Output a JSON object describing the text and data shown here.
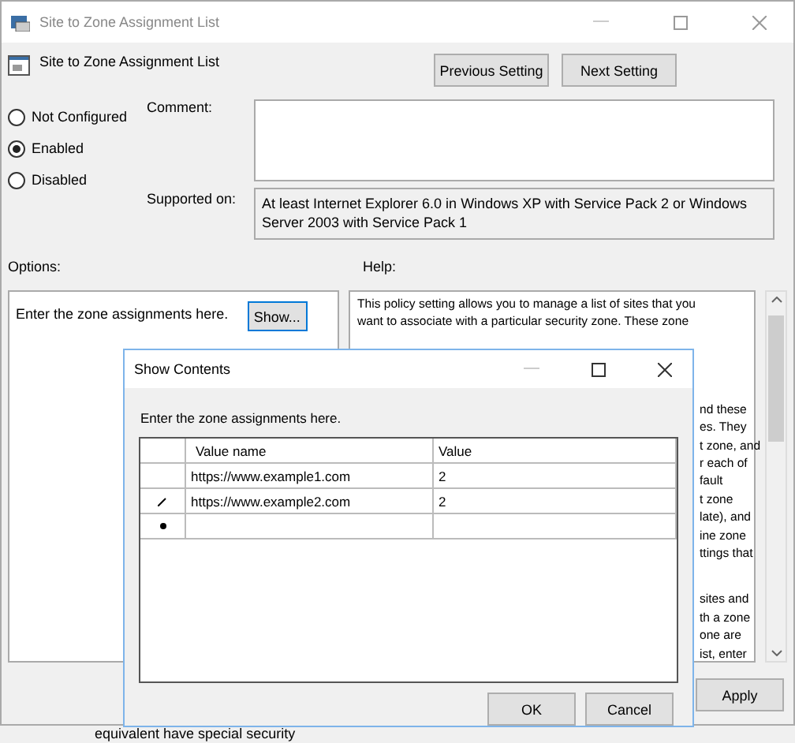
{
  "window": {
    "title": "Site to Zone Assignment List"
  },
  "header": {
    "title": "Site to Zone Assignment List",
    "buttons": [
      "Previous Setting",
      "Next Setting"
    ]
  },
  "state_options": [
    {
      "label": "Not Configured",
      "selected": false
    },
    {
      "label": "Enabled",
      "selected": true
    },
    {
      "label": "Disabled",
      "selected": false
    }
  ],
  "comment": {
    "label": "Comment:"
  },
  "supported_on": {
    "label": "Supported on:",
    "value": "At least Internet Explorer 6.0 in Windows XP with Service Pack 2 or Windows Server 2003 with Service Pack 1"
  },
  "options": {
    "label": "Options:",
    "text": "Enter the zone assignments here.",
    "button": "Show..."
  },
  "help": {
    "label": "Help:",
    "lines": [
      "This policy setting allows you to manage a list of sites that you",
      "want to associate with a particular security zone. These zone"
    ],
    "fragment_paragraphs": [
      [
        "nd these",
        "es. They",
        "t zone, and",
        "r each of",
        "fault",
        "t zone",
        "late), and",
        "ine zone",
        "ttings that"
      ],
      [
        "sites and",
        "th a zone",
        "one are",
        "ist, enter"
      ]
    ]
  },
  "footer_buttons": [
    "Apply"
  ],
  "dialog": {
    "title": "Show Contents",
    "label": "Enter the zone assignments here.",
    "columns": [
      "Value name",
      "Value"
    ],
    "rows": [
      {
        "kind": "plain",
        "name": "https://www.example1.com",
        "value": "2"
      },
      {
        "kind": "editing",
        "name": "https://www.example2.com",
        "value": "2"
      },
      {
        "kind": "new"
      }
    ],
    "buttons": [
      "OK",
      "Cancel"
    ]
  },
  "background_text": "equivalent have special security"
}
